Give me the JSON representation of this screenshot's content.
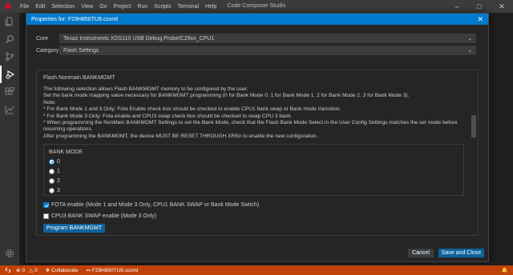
{
  "menubar": {
    "items": [
      "File",
      "Edit",
      "Selection",
      "View",
      "Go",
      "Project",
      "Run",
      "Scripts",
      "Terminal",
      "Help"
    ],
    "window_title": "Code Composer Studio"
  },
  "dialog": {
    "title": "Properties for: F29H850TU9.ccxml",
    "core_label": "Core",
    "core_value": "Texas Instruments XDS110 USB Debug Probe/C29xx_CPU1",
    "category_label": "Category",
    "category_value": "Flash Settings",
    "panel_title": "Flash Nonmain BANKMGMT",
    "description": [
      "The following selection allows Flash BANKMGMT memory to be configured by the user.",
      "Set the bank mode mapping value necessary for BANKMGMT programming (0 for Bank Mode 0, 1 for Bank Mode 1, 2 for Bank Mode 2, 3 for Bank Mode 3).",
      "Note:",
      "* For Bank Mode 1 and 3 Only: Fota Enable check box should be checked to enable CPU1 bank swap or Bank mode transition.",
      "* For Bank Mode 3 Only: Fota enable and CPU3 swap check box should be checked to swap CPU 3 bank.",
      "* When programming the NonMain BANKMGMT Settings to set the Bank Mode, check that the Flash Bank Mode Select in the User Config Settings matches the set mode before",
      "resuming operations.",
      "After programming the BANKMGMT, the device MUST BE RESET THROUGH XRSn to enable the new configuration."
    ],
    "bank_mode_title": "BANK MODE",
    "bank_modes": [
      "0",
      "1",
      "2",
      "3"
    ],
    "selected_bank_mode": "0",
    "fota_label": "FOTA enable (Mode 1 and Mode 3 Only, CPU1 BANK SWAP or Bank Mode Switch)",
    "fota_checked": true,
    "cpu3_label": "CPU3 BANK SWAP enable (Mode 3 Only)",
    "cpu3_checked": false,
    "program_button": "Program BANKMGMT",
    "cancel_button": "Cancel",
    "save_button": "Save and Close"
  },
  "statusbar": {
    "collaborate": "Collaborate",
    "file": "F29H850TU9.ccxml",
    "errors": "0",
    "warnings": "0"
  },
  "colors": {
    "accent": "#007acc",
    "statusbar": "#c1410a",
    "button": "#0e639c"
  }
}
